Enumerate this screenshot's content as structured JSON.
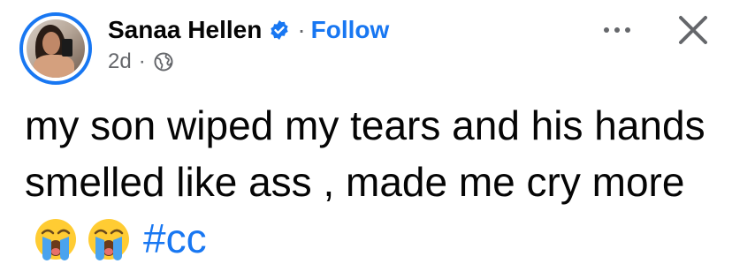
{
  "post": {
    "author": {
      "name": "Sanaa Hellen",
      "verified": true,
      "follow_label": "Follow",
      "separator": "·"
    },
    "meta": {
      "time": "2d",
      "separator": "·",
      "audience_icon": "globe-icon"
    },
    "text_body": "my son wiped my tears and his hands smelled like ass , made me cry more",
    "emojis": [
      "loudly-crying-face",
      "loudly-crying-face"
    ],
    "hashtag": "#cc"
  },
  "actions": {
    "more_icon": "more-icon",
    "close_icon": "close-icon"
  },
  "colors": {
    "accent": "#1877f2",
    "secondary_text": "#65676b",
    "primary_text": "#050505"
  }
}
